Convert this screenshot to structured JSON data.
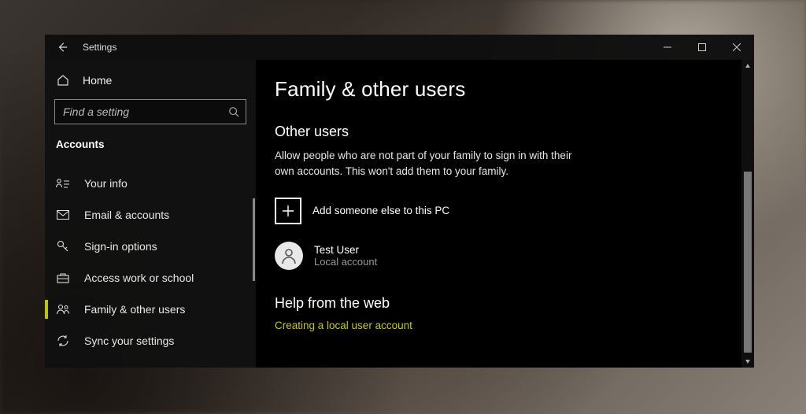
{
  "window": {
    "title": "Settings"
  },
  "sidebar": {
    "home_label": "Home",
    "search_placeholder": "Find a setting",
    "category": "Accounts",
    "items": [
      {
        "label": "Your info"
      },
      {
        "label": "Email & accounts"
      },
      {
        "label": "Sign-in options"
      },
      {
        "label": "Access work or school"
      },
      {
        "label": "Family & other users"
      },
      {
        "label": "Sync your settings"
      }
    ],
    "active_index": 4
  },
  "content": {
    "page_title": "Family & other users",
    "other_users_heading": "Other users",
    "other_users_desc": "Allow people who are not part of your family to sign in with their own accounts. This won't add them to your family.",
    "add_label": "Add someone else to this PC",
    "user": {
      "name": "Test User",
      "type": "Local account"
    },
    "help_heading": "Help from the web",
    "help_links": [
      "Creating a local user account"
    ]
  }
}
